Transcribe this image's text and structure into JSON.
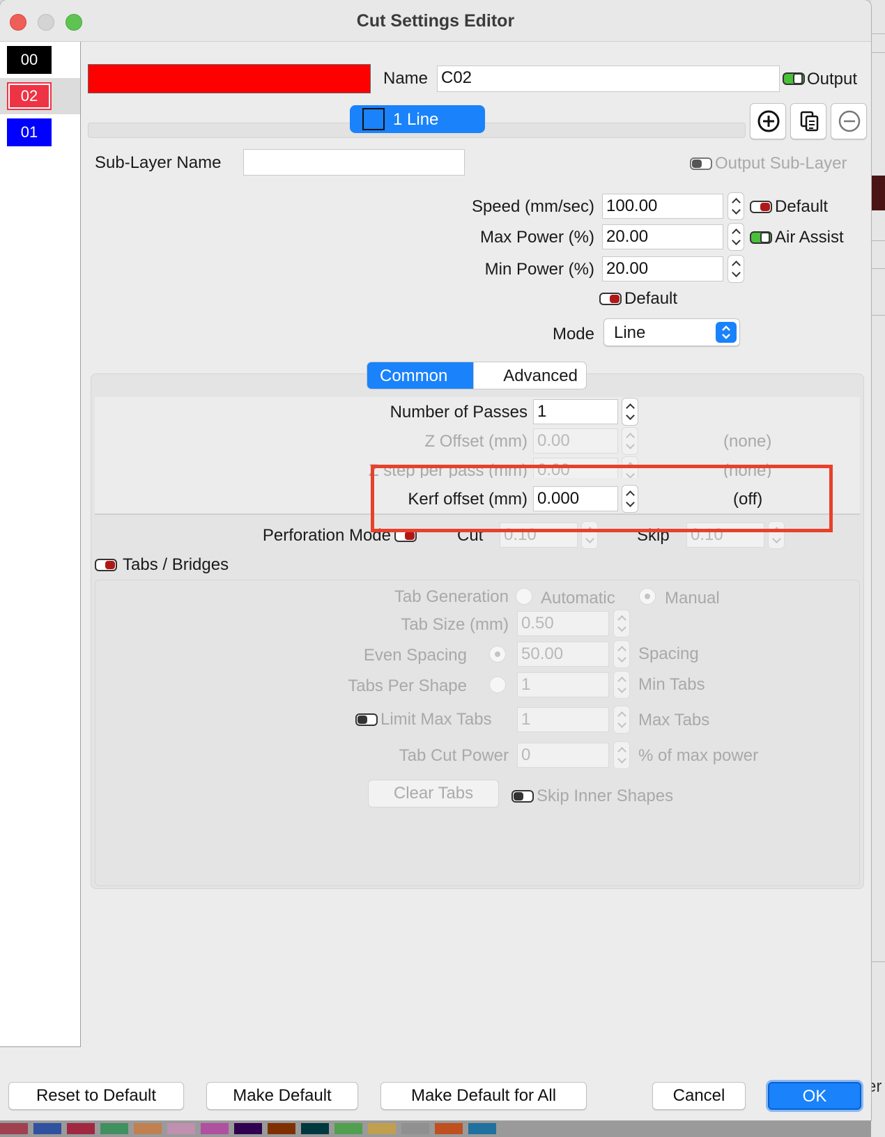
{
  "window": {
    "title": "Cut Settings Editor"
  },
  "layers": [
    {
      "label": "00",
      "color": "#000000"
    },
    {
      "label": "02",
      "color": "#ee3344"
    },
    {
      "label": "01",
      "color": "#0000ff"
    }
  ],
  "header": {
    "layer_color": "#ff0000",
    "name_label": "Name",
    "name_value": "C02",
    "output_label": "Output",
    "sublayer_tab": "1 Line"
  },
  "sublayer": {
    "name_label": "Sub-Layer Name",
    "name_value": "",
    "output_label": "Output Sub-Layer"
  },
  "power": {
    "speed_label": "Speed (mm/sec)",
    "speed_value": "100.00",
    "speed_default_label": "Default",
    "max_label": "Max Power (%)",
    "max_value": "20.00",
    "air_assist_label": "Air Assist",
    "min_label": "Min Power (%)",
    "min_value": "20.00",
    "power_default_label": "Default",
    "mode_label": "Mode",
    "mode_value": "Line"
  },
  "tabs": {
    "common": "Common",
    "advanced": "Advanced"
  },
  "common": {
    "passes_label": "Number of Passes",
    "passes_value": "1",
    "zoffset_label": "Z Offset (mm)",
    "zoffset_value": "0.00",
    "zoffset_status": "(none)",
    "zstep_label": "Z step per pass (mm)",
    "zstep_value": "0.00",
    "zstep_status": "(none)",
    "kerf_label": "Kerf offset (mm)",
    "kerf_value": "0.000",
    "kerf_status": "(off)",
    "perf_label": "Perforation Mode",
    "cut_label": "Cut",
    "cut_value": "0.10",
    "skip_label": "Skip",
    "skip_value": "0.10"
  },
  "tabs_section": {
    "title": "Tabs / Bridges",
    "generation_label": "Tab Generation",
    "automatic_label": "Automatic",
    "manual_label": "Manual",
    "size_label": "Tab Size (mm)",
    "size_value": "0.50",
    "even_label": "Even Spacing",
    "even_value": "50.00",
    "spacing_label": "Spacing",
    "per_shape_label": "Tabs Per Shape",
    "per_shape_value": "1",
    "min_tabs_label": "Min Tabs",
    "limit_label": "Limit Max Tabs",
    "limit_value": "1",
    "max_tabs_label": "Max Tabs",
    "cut_power_label": "Tab Cut Power",
    "cut_power_value": "0",
    "cut_power_unit": "% of max power",
    "clear_label": "Clear Tabs",
    "skip_inner_label": "Skip Inner Shapes"
  },
  "footer": {
    "reset": "Reset to Default",
    "make_default": "Make Default",
    "make_default_all": "Make Default for All",
    "cancel": "Cancel",
    "ok": "OK"
  },
  "background": {
    "tail_text": "er"
  },
  "colors": {
    "accent": "#1a82fb",
    "highlight_box": "#e8402a",
    "toggle_on": "#49c03a",
    "toggle_red": "#b01818"
  }
}
